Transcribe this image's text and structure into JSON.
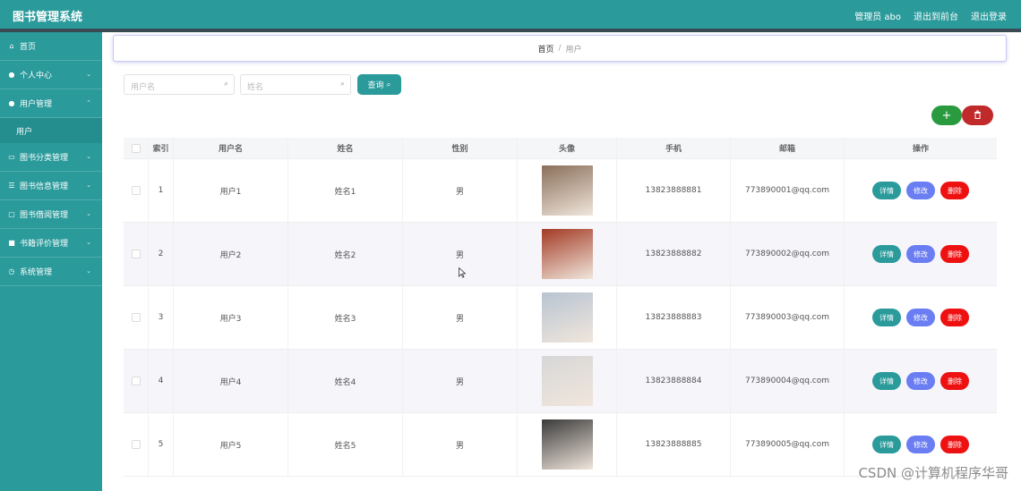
{
  "app": {
    "title": "图书管理系统",
    "top_actions": [
      "管理员 abo",
      "退出到前台",
      "退出登录"
    ]
  },
  "sidebar": {
    "items": [
      {
        "label": "首页",
        "icon": "home-icon",
        "glyph": "⌂",
        "chevron": false
      },
      {
        "label": "个人中心",
        "icon": "user-icon",
        "glyph": "●",
        "chevron": true
      },
      {
        "label": "用户管理",
        "icon": "user-icon",
        "glyph": "●",
        "chevron": true,
        "sub": "用户"
      },
      {
        "label": "图书分类管理",
        "icon": "category-icon",
        "glyph": "▭",
        "chevron": true
      },
      {
        "label": "图书信息管理",
        "icon": "list-icon",
        "glyph": "☰",
        "chevron": true
      },
      {
        "label": "图书借阅管理",
        "icon": "borrow-icon",
        "glyph": "▢",
        "chevron": true
      },
      {
        "label": "书籍评价管理",
        "icon": "review-icon",
        "glyph": "■",
        "chevron": true
      },
      {
        "label": "系统管理",
        "icon": "settings-icon",
        "glyph": "◷",
        "chevron": true
      }
    ]
  },
  "breadcrumb": {
    "home": "首页",
    "current": "用户"
  },
  "search": {
    "username_placeholder": "用户名",
    "name_placeholder": "姓名",
    "query_label": "查询"
  },
  "toolbar": {
    "add_label": "+",
    "delete_icon": "trash-icon"
  },
  "table": {
    "columns": [
      "索引",
      "用户名",
      "姓名",
      "性别",
      "头像",
      "手机",
      "邮箱",
      "操作"
    ],
    "rows": [
      {
        "index": "1",
        "username": "用户1",
        "name": "姓名1",
        "gender": "男",
        "avatar_color": "#8a6f5a",
        "phone": "13823888881",
        "email": "773890001@qq.com"
      },
      {
        "index": "2",
        "username": "用户2",
        "name": "姓名2",
        "gender": "男",
        "avatar_color": "#a33a24",
        "phone": "13823888882",
        "email": "773890002@qq.com"
      },
      {
        "index": "3",
        "username": "用户3",
        "name": "姓名3",
        "gender": "男",
        "avatar_color": "#b8c4d2",
        "phone": "13823888883",
        "email": "773890003@qq.com"
      },
      {
        "index": "4",
        "username": "用户4",
        "name": "姓名4",
        "gender": "男",
        "avatar_color": "#d7d7d7",
        "phone": "13823888884",
        "email": "773890004@qq.com"
      },
      {
        "index": "5",
        "username": "用户5",
        "name": "姓名5",
        "gender": "男",
        "avatar_color": "#3b3b3b",
        "phone": "13823888885",
        "email": "773890005@qq.com"
      }
    ],
    "ops": {
      "detail": "详情",
      "edit": "修改",
      "delete": "删除"
    }
  },
  "colors": {
    "primary": "#2a9a9b",
    "add": "#2a9a3f",
    "danger": "#ee1111",
    "edit": "#6a7df2"
  },
  "watermark": "CSDN @计算机程序华哥"
}
